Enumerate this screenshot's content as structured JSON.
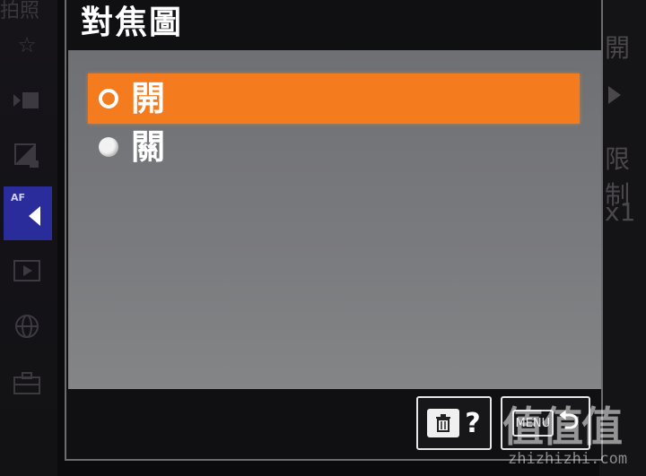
{
  "dialog": {
    "title": "對焦圖"
  },
  "options": [
    {
      "label": "開",
      "selected": true
    },
    {
      "label": "關",
      "selected": false
    }
  ],
  "footer": {
    "delete_help_glyph": "?",
    "menu_label": "MENU",
    "back_glyph": "⮌"
  },
  "background": {
    "top_left_text": "拍照",
    "af_label": "AF",
    "right_texts": [
      "開",
      "限制",
      "x1"
    ]
  },
  "watermark": {
    "logo": "值值值",
    "url": "zhizhizhi.com"
  },
  "colors": {
    "selected_accent": "#f47b1e",
    "af_tab": "#2b2c9b",
    "panel": "#7a7b7e"
  },
  "icons": [
    "star-icon",
    "movie-icon",
    "exposure-icon",
    "af-tab-icon",
    "playback-icon",
    "network-icon",
    "toolbox-icon",
    "trash-icon",
    "help-icon",
    "back-icon"
  ]
}
